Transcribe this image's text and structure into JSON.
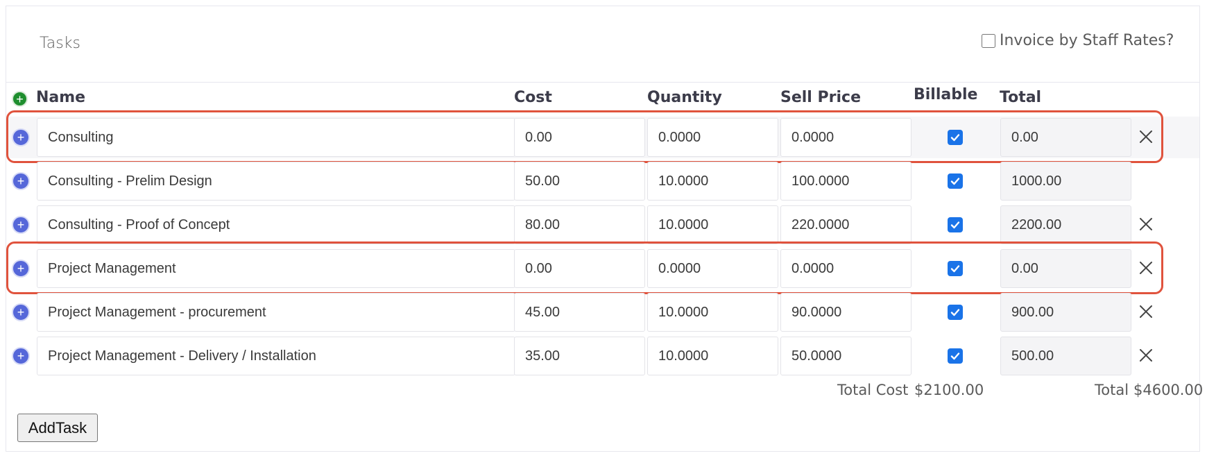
{
  "header": {
    "title": "Tasks",
    "invoice_by_staff_label": "Invoice by Staff Rates?"
  },
  "columns": {
    "name": "Name",
    "cost": "Cost",
    "quantity": "Quantity",
    "sell_price": "Sell Price",
    "billable": "Billable",
    "total": "Total"
  },
  "rows": [
    {
      "name": "Consulting",
      "cost": "0.00",
      "quantity": "0.0000",
      "sell_price": "0.0000",
      "billable": true,
      "total": "0.00",
      "deletable": true,
      "highlighted": true
    },
    {
      "name": "Consulting - Prelim Design",
      "cost": "50.00",
      "quantity": "10.0000",
      "sell_price": "100.0000",
      "billable": true,
      "total": "1000.00",
      "deletable": false,
      "highlighted": false
    },
    {
      "name": "Consulting - Proof of Concept",
      "cost": "80.00",
      "quantity": "10.0000",
      "sell_price": "220.0000",
      "billable": true,
      "total": "2200.00",
      "deletable": true,
      "highlighted": false
    },
    {
      "name": "Project Management",
      "cost": "0.00",
      "quantity": "0.0000",
      "sell_price": "0.0000",
      "billable": true,
      "total": "0.00",
      "deletable": true,
      "highlighted": true
    },
    {
      "name": "Project Management - procurement",
      "cost": "45.00",
      "quantity": "10.0000",
      "sell_price": "90.0000",
      "billable": true,
      "total": "900.00",
      "deletable": true,
      "highlighted": false
    },
    {
      "name": "Project Management - Delivery / Installation",
      "cost": "35.00",
      "quantity": "10.0000",
      "sell_price": "50.0000",
      "billable": true,
      "total": "500.00",
      "deletable": true,
      "highlighted": false
    }
  ],
  "summary": {
    "total_cost_label": "Total Cost",
    "total_cost_value": "$2100.00",
    "total_label": "Total",
    "total_value": "$4600.00"
  },
  "buttons": {
    "add_task": "AddTask"
  },
  "colors": {
    "highlight_border": "#e0533d",
    "add_subtask": "#5567d9",
    "add_task_green": "#1e8e2e",
    "checkbox": "#1a73e8"
  },
  "icons": {
    "add_root": "plus-circle-icon",
    "add_subtask": "plus-circle-icon",
    "delete": "close-icon",
    "billable": "checkbox-checked-icon"
  }
}
